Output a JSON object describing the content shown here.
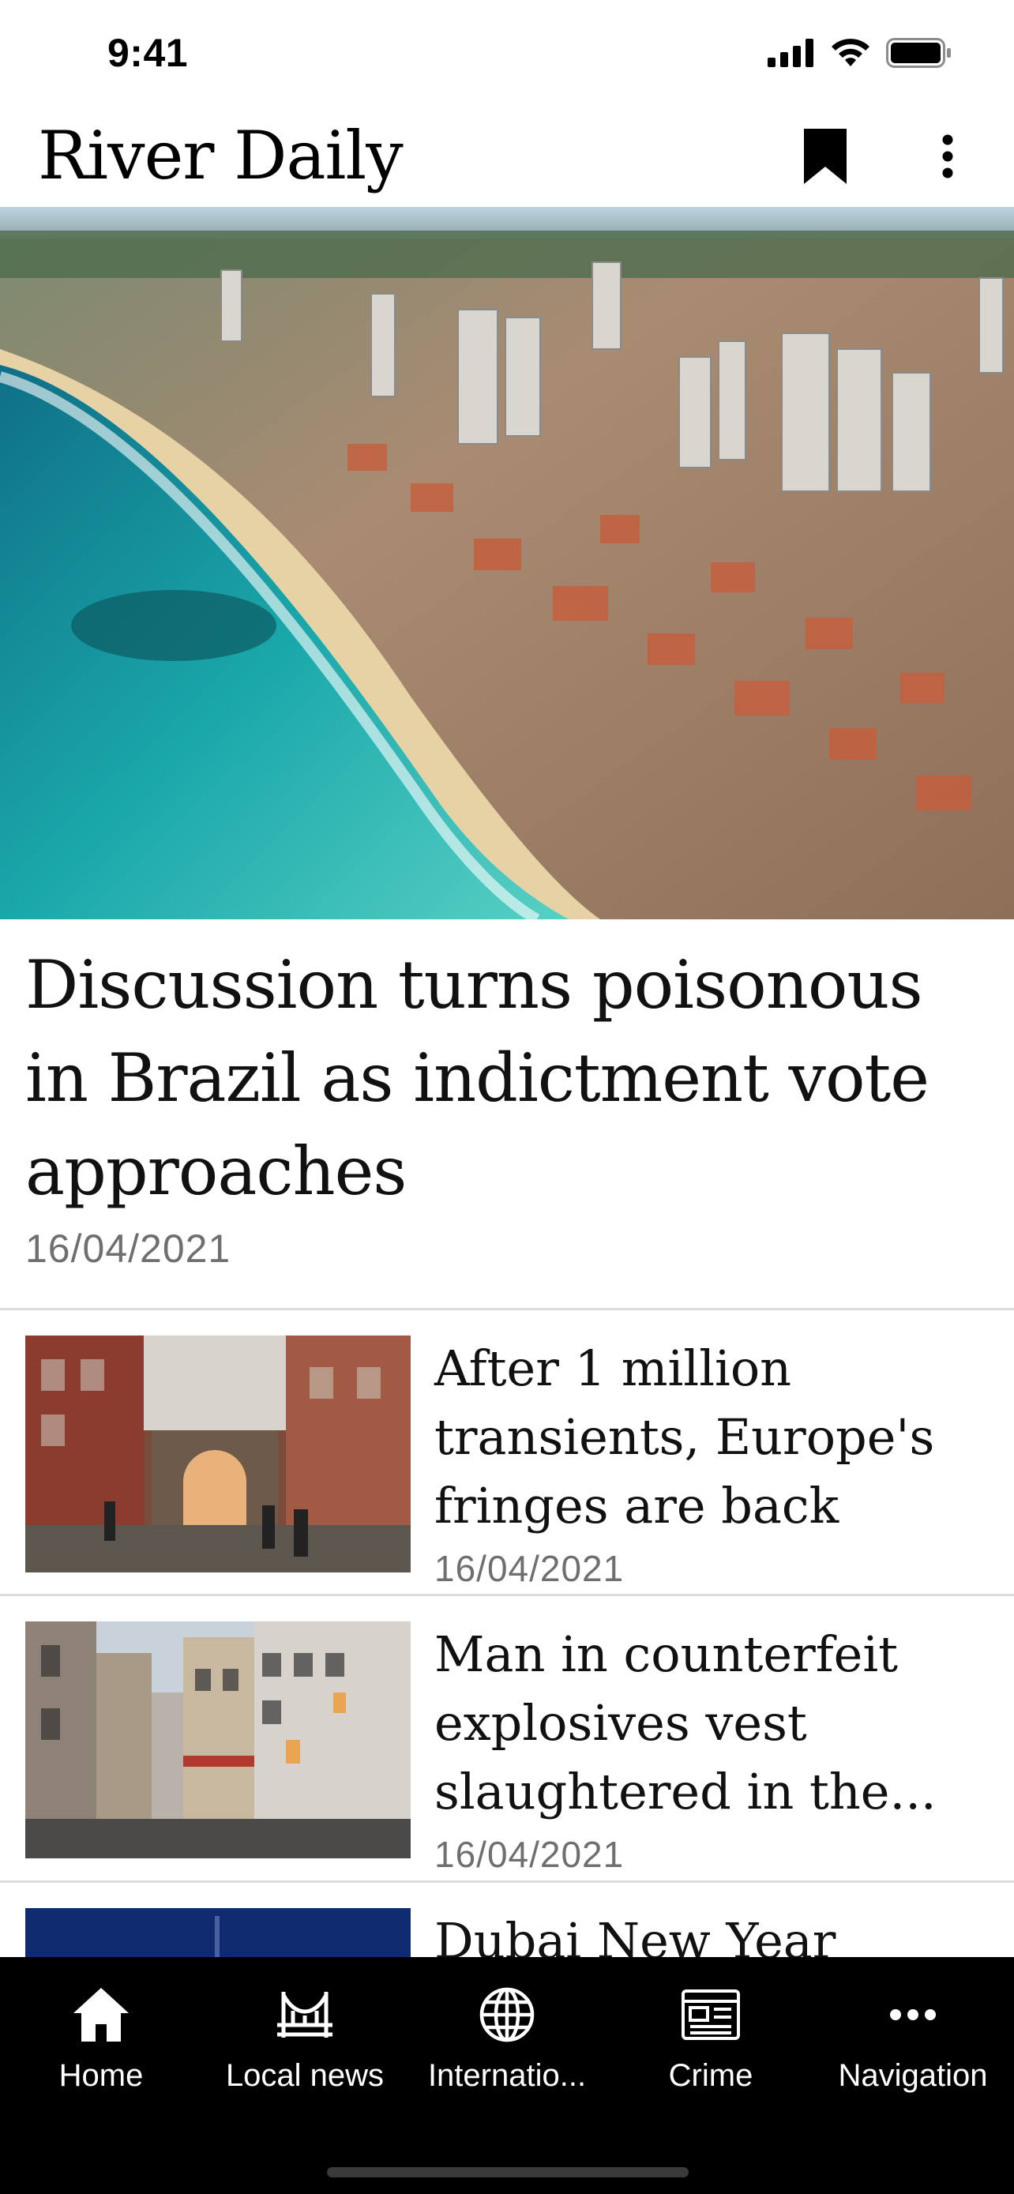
{
  "status_bar": {
    "time": "9:41"
  },
  "app": {
    "title": "River Daily"
  },
  "header_icons": {
    "bookmark": "bookmark-icon",
    "more": "more-vertical-icon"
  },
  "hero": {
    "image": "coastal-city-aerial-photo",
    "title": "Discussion turns poisonous in Brazil as indictment vote approaches",
    "date": "16/04/2021"
  },
  "articles": [
    {
      "headline": "After 1 million transients, Europe's fringes are back",
      "date": "16/04/2021",
      "image": "european-street-stairs-photo"
    },
    {
      "headline": "Man in counterfeit explosives vest slaughtered in the...",
      "date": "16/04/2021",
      "image": "paris-street-photo"
    },
    {
      "headline": "Dubai New Year",
      "date": "",
      "image": "night-sky-photo"
    }
  ],
  "tabs": [
    {
      "label": "Home",
      "icon": "home-icon"
    },
    {
      "label": "Local news",
      "icon": "bridge-icon"
    },
    {
      "label": "Internatio...",
      "icon": "globe-icon"
    },
    {
      "label": "Crime",
      "icon": "newspaper-icon"
    },
    {
      "label": "Navigation",
      "icon": "more-horizontal-icon"
    }
  ],
  "colors": {
    "tab_bar_bg": "#000000",
    "date_text": "#6f6f6f",
    "divider": "#dcdcdc"
  }
}
